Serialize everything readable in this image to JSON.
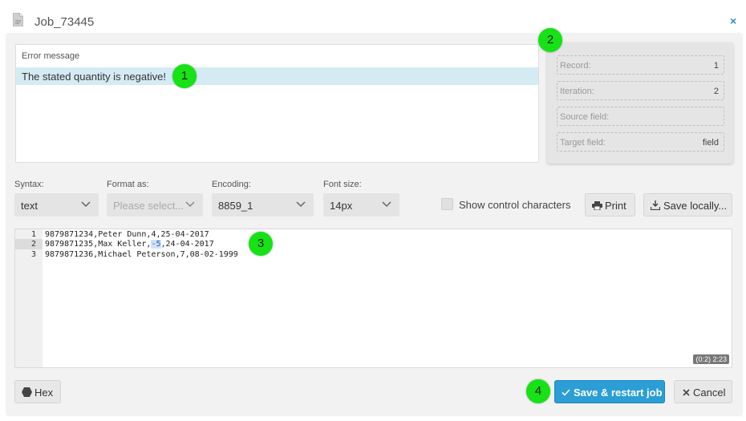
{
  "window": {
    "title": "Job_73445",
    "close_glyph": "×"
  },
  "error_panel": {
    "header": "Error message",
    "message": "The stated quantity is negative!"
  },
  "info_panel": {
    "fields": [
      {
        "label": "Record:",
        "value": "1"
      },
      {
        "label": "Iteration:",
        "value": "2"
      },
      {
        "label": "Source field:",
        "value": ""
      },
      {
        "label": "Target field:",
        "value": "field"
      }
    ]
  },
  "toolbar": {
    "syntax": {
      "label": "Syntax:",
      "value": "text"
    },
    "format_as": {
      "label": "Format as:",
      "placeholder": "Please select..."
    },
    "encoding": {
      "label": "Encoding:",
      "value": "8859_1"
    },
    "font_size": {
      "label": "Font size:",
      "value": "14px"
    },
    "show_control_chars": {
      "label": "Show control characters",
      "checked": false
    },
    "print_label": "Print",
    "save_locally_label": "Save locally..."
  },
  "editor": {
    "lines": [
      {
        "number": "1",
        "before": "9879871234,Peter Dunn,4,25-04-2017",
        "selected": "",
        "after": ""
      },
      {
        "number": "2",
        "before": "9879871235,Max Keller,",
        "selected": "-5",
        "after": ",24-04-2017"
      },
      {
        "number": "3",
        "before": "9879871236,Michael Peterson,7,08-02-1999",
        "selected": "",
        "after": ""
      }
    ],
    "highlighted_line": 2,
    "cursor_position": "(0:2) 2:23"
  },
  "footer": {
    "hex_label": "Hex",
    "save_restart_label": "Save & restart job",
    "cancel_label": "Cancel"
  },
  "badges": [
    "1",
    "2",
    "3",
    "4"
  ],
  "colors": {
    "accent": "#2b9ed6",
    "selection_row": "#d5ebf3",
    "badge": "#16e216"
  },
  "icons": {
    "window": "document-icon",
    "close": "close-icon",
    "print": "printer-icon",
    "save_locally": "download-icon",
    "hex": "hexagon-icon",
    "save_restart": "checkmark-icon",
    "cancel": "x-icon"
  }
}
